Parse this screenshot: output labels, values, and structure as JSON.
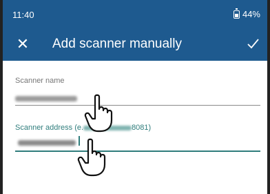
{
  "status": {
    "time": "11:40",
    "battery": "44%"
  },
  "appbar": {
    "title": "Add scanner manually",
    "close_icon": "close-icon",
    "confirm_icon": "check-icon"
  },
  "form": {
    "name_label": "Scanner name",
    "name_value": "",
    "address_label_start": "Scanner address (e.",
    "address_label_end": "8081)",
    "address_value": ""
  },
  "colors": {
    "bar": "#1e5a8f",
    "accent": "#2f7d7c"
  }
}
